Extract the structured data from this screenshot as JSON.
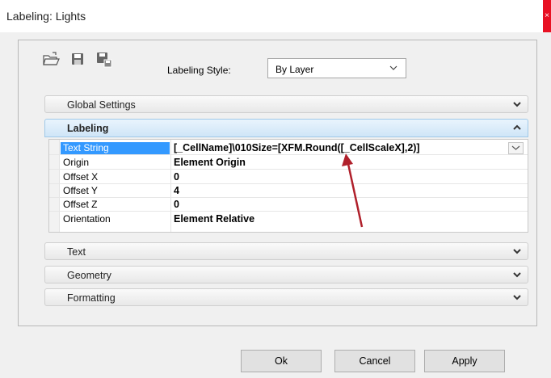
{
  "window": {
    "title": "Labeling: Lights",
    "close_glyph": "×"
  },
  "toolbar": {
    "icons": [
      "open-folder-icon",
      "save-icon",
      "save-as-icon"
    ],
    "labeling_style_label": "Labeling Style:",
    "labeling_style_value": "By Layer"
  },
  "sections": {
    "global_settings": "Global Settings",
    "labeling": "Labeling",
    "text": "Text",
    "geometry": "Geometry",
    "formatting": "Formatting"
  },
  "labeling_properties": [
    {
      "name": "Text String",
      "value": "[_CellName]\\010Size=[XFM.Round([_CellScaleX],2)]"
    },
    {
      "name": "Origin",
      "value": "Element Origin"
    },
    {
      "name": "Offset X",
      "value": "0"
    },
    {
      "name": "Offset Y",
      "value": "4"
    },
    {
      "name": "Offset Z",
      "value": "0"
    },
    {
      "name": "Orientation",
      "value": "Element Relative"
    }
  ],
  "annotation": {
    "arrow_color": "#b0202b"
  },
  "buttons": {
    "ok": "Ok",
    "cancel": "Cancel",
    "apply": "Apply"
  },
  "colors": {
    "selection": "#3399ff",
    "close": "#e81123"
  }
}
